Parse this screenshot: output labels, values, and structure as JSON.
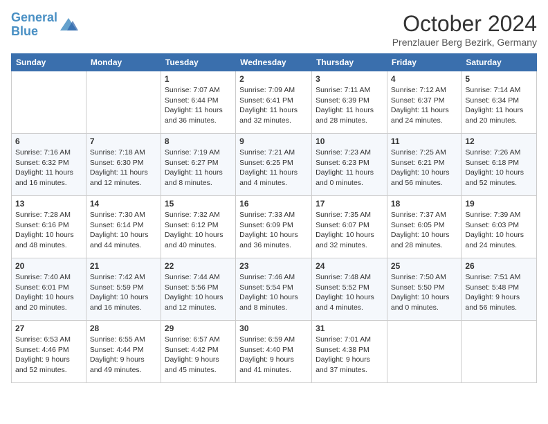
{
  "header": {
    "logo_line1": "General",
    "logo_line2": "Blue",
    "month": "October 2024",
    "location": "Prenzlauer Berg Bezirk, Germany"
  },
  "weekdays": [
    "Sunday",
    "Monday",
    "Tuesday",
    "Wednesday",
    "Thursday",
    "Friday",
    "Saturday"
  ],
  "weeks": [
    [
      {
        "day": "",
        "content": ""
      },
      {
        "day": "",
        "content": ""
      },
      {
        "day": "1",
        "content": "Sunrise: 7:07 AM\nSunset: 6:44 PM\nDaylight: 11 hours and 36 minutes."
      },
      {
        "day": "2",
        "content": "Sunrise: 7:09 AM\nSunset: 6:41 PM\nDaylight: 11 hours and 32 minutes."
      },
      {
        "day": "3",
        "content": "Sunrise: 7:11 AM\nSunset: 6:39 PM\nDaylight: 11 hours and 28 minutes."
      },
      {
        "day": "4",
        "content": "Sunrise: 7:12 AM\nSunset: 6:37 PM\nDaylight: 11 hours and 24 minutes."
      },
      {
        "day": "5",
        "content": "Sunrise: 7:14 AM\nSunset: 6:34 PM\nDaylight: 11 hours and 20 minutes."
      }
    ],
    [
      {
        "day": "6",
        "content": "Sunrise: 7:16 AM\nSunset: 6:32 PM\nDaylight: 11 hours and 16 minutes."
      },
      {
        "day": "7",
        "content": "Sunrise: 7:18 AM\nSunset: 6:30 PM\nDaylight: 11 hours and 12 minutes."
      },
      {
        "day": "8",
        "content": "Sunrise: 7:19 AM\nSunset: 6:27 PM\nDaylight: 11 hours and 8 minutes."
      },
      {
        "day": "9",
        "content": "Sunrise: 7:21 AM\nSunset: 6:25 PM\nDaylight: 11 hours and 4 minutes."
      },
      {
        "day": "10",
        "content": "Sunrise: 7:23 AM\nSunset: 6:23 PM\nDaylight: 11 hours and 0 minutes."
      },
      {
        "day": "11",
        "content": "Sunrise: 7:25 AM\nSunset: 6:21 PM\nDaylight: 10 hours and 56 minutes."
      },
      {
        "day": "12",
        "content": "Sunrise: 7:26 AM\nSunset: 6:18 PM\nDaylight: 10 hours and 52 minutes."
      }
    ],
    [
      {
        "day": "13",
        "content": "Sunrise: 7:28 AM\nSunset: 6:16 PM\nDaylight: 10 hours and 48 minutes."
      },
      {
        "day": "14",
        "content": "Sunrise: 7:30 AM\nSunset: 6:14 PM\nDaylight: 10 hours and 44 minutes."
      },
      {
        "day": "15",
        "content": "Sunrise: 7:32 AM\nSunset: 6:12 PM\nDaylight: 10 hours and 40 minutes."
      },
      {
        "day": "16",
        "content": "Sunrise: 7:33 AM\nSunset: 6:09 PM\nDaylight: 10 hours and 36 minutes."
      },
      {
        "day": "17",
        "content": "Sunrise: 7:35 AM\nSunset: 6:07 PM\nDaylight: 10 hours and 32 minutes."
      },
      {
        "day": "18",
        "content": "Sunrise: 7:37 AM\nSunset: 6:05 PM\nDaylight: 10 hours and 28 minutes."
      },
      {
        "day": "19",
        "content": "Sunrise: 7:39 AM\nSunset: 6:03 PM\nDaylight: 10 hours and 24 minutes."
      }
    ],
    [
      {
        "day": "20",
        "content": "Sunrise: 7:40 AM\nSunset: 6:01 PM\nDaylight: 10 hours and 20 minutes."
      },
      {
        "day": "21",
        "content": "Sunrise: 7:42 AM\nSunset: 5:59 PM\nDaylight: 10 hours and 16 minutes."
      },
      {
        "day": "22",
        "content": "Sunrise: 7:44 AM\nSunset: 5:56 PM\nDaylight: 10 hours and 12 minutes."
      },
      {
        "day": "23",
        "content": "Sunrise: 7:46 AM\nSunset: 5:54 PM\nDaylight: 10 hours and 8 minutes."
      },
      {
        "day": "24",
        "content": "Sunrise: 7:48 AM\nSunset: 5:52 PM\nDaylight: 10 hours and 4 minutes."
      },
      {
        "day": "25",
        "content": "Sunrise: 7:50 AM\nSunset: 5:50 PM\nDaylight: 10 hours and 0 minutes."
      },
      {
        "day": "26",
        "content": "Sunrise: 7:51 AM\nSunset: 5:48 PM\nDaylight: 9 hours and 56 minutes."
      }
    ],
    [
      {
        "day": "27",
        "content": "Sunrise: 6:53 AM\nSunset: 4:46 PM\nDaylight: 9 hours and 52 minutes."
      },
      {
        "day": "28",
        "content": "Sunrise: 6:55 AM\nSunset: 4:44 PM\nDaylight: 9 hours and 49 minutes."
      },
      {
        "day": "29",
        "content": "Sunrise: 6:57 AM\nSunset: 4:42 PM\nDaylight: 9 hours and 45 minutes."
      },
      {
        "day": "30",
        "content": "Sunrise: 6:59 AM\nSunset: 4:40 PM\nDaylight: 9 hours and 41 minutes."
      },
      {
        "day": "31",
        "content": "Sunrise: 7:01 AM\nSunset: 4:38 PM\nDaylight: 9 hours and 37 minutes."
      },
      {
        "day": "",
        "content": ""
      },
      {
        "day": "",
        "content": ""
      }
    ]
  ]
}
